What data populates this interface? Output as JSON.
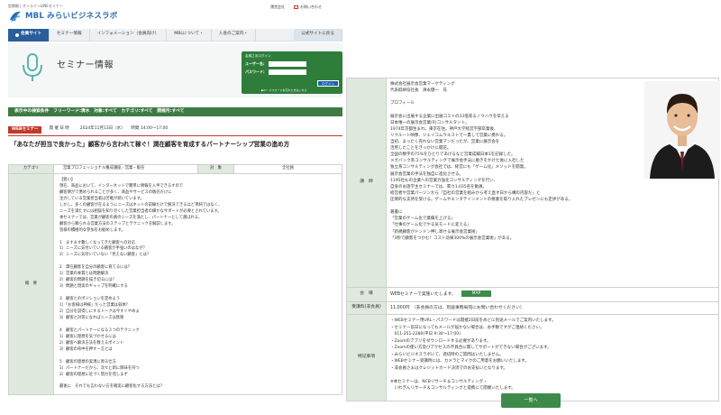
{
  "header": {
    "top_line": "定期制 | オンラインLINEセミナー",
    "logo_text": "MBL みらいビジネスラボ",
    "util_links": [
      "運営会社",
      "お問い合わせ"
    ]
  },
  "nav": {
    "items": [
      "会員サイト",
      "セミナー情報",
      "インフォメーション（会員向け）",
      "MBLについて・",
      "入会のご案内・",
      "公式サイトに戻る"
    ]
  },
  "title_banner": {
    "title": "セミナー情報",
    "login": {
      "title": "会員さまログイン",
      "user_label": "ユーザー名:",
      "password_label": "パスワード:",
      "button": "ログイン",
      "reminder": "▶ID・パスワードを忘れた方はこちら"
    }
  },
  "conditions_bar": "表示中の検索条件　フリーワード:清水　対象:すべて　カテゴリ:すべて　開催月:すべて",
  "date_row": {
    "tag": "WEBセミナー",
    "label": "開 催 日 時",
    "value": "2024年11月13日（水）　　時間 14:00～17:00"
  },
  "seminar_title": "「あなたが担当で良かった」顧客から言われて稼ぐ！潤在顧客を育成するパートナーシップ営業の進め方",
  "info_table": {
    "category_label": "カテゴリ",
    "category_value": "営業プロフェッショナル養成講座／営業・販売",
    "target_label": "対　象",
    "target_value": "全社員",
    "overview_label": "概　要",
    "overview_text": "【狙い】\n現在、商品において、インターネットで簡単に情報を入手できるすので\n顧客側がで悪められることが多く、商品やサービスの販売だけに\n注力している営業担当者は苦戦が続いています。\nしかし、多くの顧客が在るようにニーズはネットの前線だけで解決できるほど単純ではなく、\nニーズを満たすには相談を知り尽くした営業担当者の細かなサポートが必要とされています。\n本セミナーでは、営業が顧客の真のニーズを満たし、パートナーとして選ばれる、\n顧客から頼られる営業方法のステップとテクニックを解説します。\n皆様の積極的な参加をお勧めします。\n\n1　ますます難しくなってきた顧客への対応\n1）ニーズに気付いている顧客が手強いのはなぜ？\n2）ニーズに気付いていない「見えない顧客」とは？\n\n2　潤在顧客を自分の顧客に育てるには？\n1）営業の本質とは問題解決\n2）顧客の問題を描き切るには？\n3）問題と現実のギャップを明確にする\n\n3　顧客とのポジションを定めよう\n1）「お客様は神様」だった営業は弱体？\n2）自分を説得しにするトークは今すぐやめよ\n3）顧客と対等になればニーズは無限\n\n4　顧客とパートナーになる３つのテクニック\n1）顧客に理想を気づかせるには\n2）顧客へ解決方法を教えるポイント\n3）顧客の背中を押す一言とは\n\n5　顧客の理想の実現に周る仕方\n1）パートナーだから、次々と新に興味を持つ\n2）顧客の理想に近づく努力を惜しまず\n\n最後に　それでも言わない方を確実に顧客化する方法とは？"
  },
  "right_table": {
    "lecturer_label": "講　師",
    "lecturer_text": "株式会社展示会営業マーケティング\n代表取締役社長　清永健一　氏\n\nプロフィール\n\n展示会に出展する企業に出展コストの33倍売るノウハウを伝える\n日本唯一の展示会営業(R)コンサルタント。\n1974年京都生まれ。東京在住。神戸大学経営学部卒業後、\nリクルート映像、ジェイコムウエストで一貫して営業に携わる。\n当初、まったく売れない営業マンだったが、営業に展示会を\n活用したことをきっかけに開花。\n全国の数字の75%をひとりであげるなど営業成績日本1を記録した。\nメガバンク系コンサルティングで展示会手法に磨きをかけた後に入社した\n独立系コンサルティング会社では、経営にも「ゲーム化」メソッドを開発。\n展示会営業の手法を独自に進化させる。\n1195社もの企業への営業力強化コンサルティングを行い、\n自身のお語学主セミナーでは、累々1,035名を動員。\n経営者や営業パーソンから「自社の営業を組みから考え直す日から構の内容だ」と\n圧倒的な支持を受ける。ゲームやエンタテインメントの要素を取り入れたプレゼンにも定評がある。\n\n著書に\n「営業のゲーム化で業績を上げる」\n「仕事のゲーム化でやる気モードに変える」\n「新規顧客がドンドン押し寄せる展示会営業術」\n「3秒で顧客をつかむ！コスト効果300%の展示会営業術」がある。",
    "venue_label": "会　場",
    "venue_value": "WEBセミナーで実施いたします。",
    "map_button": "MAP",
    "fee_label": "受講料(非会員)",
    "fee_value": "11,000円　（非会員の方は、別途事務局宛にお問い合わせください）",
    "notes_label": "特記事項",
    "notes_text": "・WEBセミナー用URL・パスワードは開催2日前をめどに別途メールでご案内いたします。\n・セミナー前日になってもメールが届かない場合は、お手数ですがご連絡ください。\n　011-251-2280(平日 9:30～17:00)\n・Zoomのアプリをダウンロードする必要があります。\n・Zoomの使い方及びアクセスの不具合に関してサポートができない場合がございます。\n・みらいビジネスラボにて、適切時のご質問はいたしません。\n・WEBセミナー受講時には、カメラとマイクのご用意をお願いいたします。\n・非会員さまはクレジットカード決済でのお支払いとなります。\n\n※本セミナーは、NCBリサーチ＆コンサルティング・\n　いわぎんリサーチ＆コンサルティングと提携にて開催いたします。"
  },
  "ichiran_button": "一覧へ",
  "colors": {
    "nav_active": "#2a5d9a",
    "green": "#3e8a4a",
    "red_tag": "#c0392b",
    "header_cell": "#dfe9de"
  }
}
